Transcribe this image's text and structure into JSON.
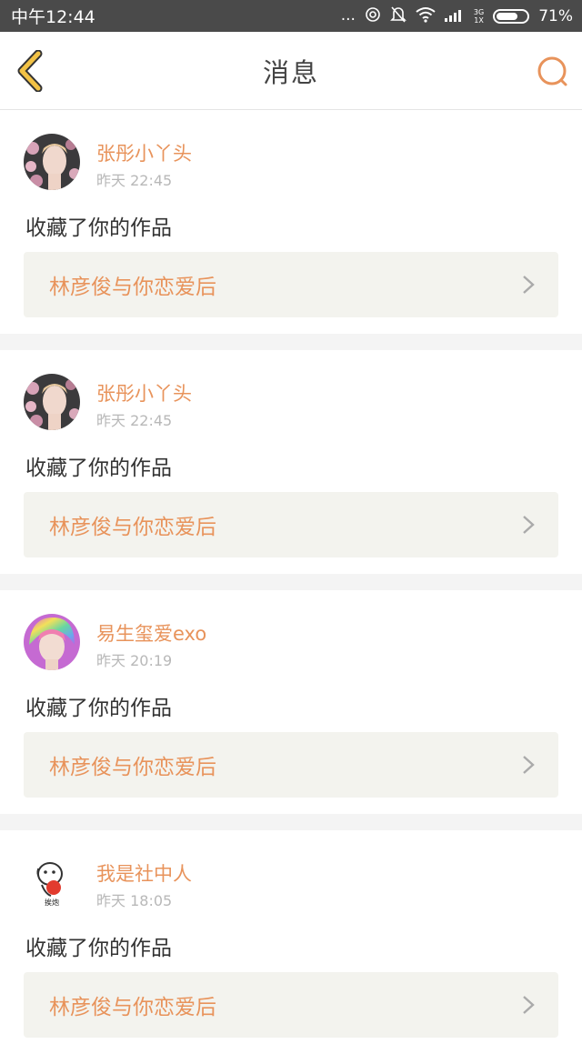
{
  "status_bar": {
    "time": "中午12:44",
    "dots": "...",
    "network_top": "3G",
    "network_bottom": "1X",
    "battery": "71%"
  },
  "header": {
    "title": "消息",
    "back_icon": "chevron-left-icon",
    "search_icon": "search-icon"
  },
  "colors": {
    "accent": "#e8935b",
    "back_chevron": "#f2c245",
    "work_bg": "#f3f3ee"
  },
  "messages": [
    {
      "user": "张彤小丫头",
      "time": "昨天 22:45",
      "action": "收藏了你的作品",
      "work": "林彦俊与你恋爱后"
    },
    {
      "user": "张彤小丫头",
      "time": "昨天 22:45",
      "action": "收藏了你的作品",
      "work": "林彦俊与你恋爱后"
    },
    {
      "user": "易生玺爱exo",
      "time": "昨天 20:19",
      "action": "收藏了你的作品",
      "work": "林彦俊与你恋爱后"
    },
    {
      "user": "我是社中人",
      "time": "昨天 18:05",
      "action": "收藏了你的作品",
      "work": "林彦俊与你恋爱后",
      "avatar_caption": "挨炮"
    }
  ]
}
